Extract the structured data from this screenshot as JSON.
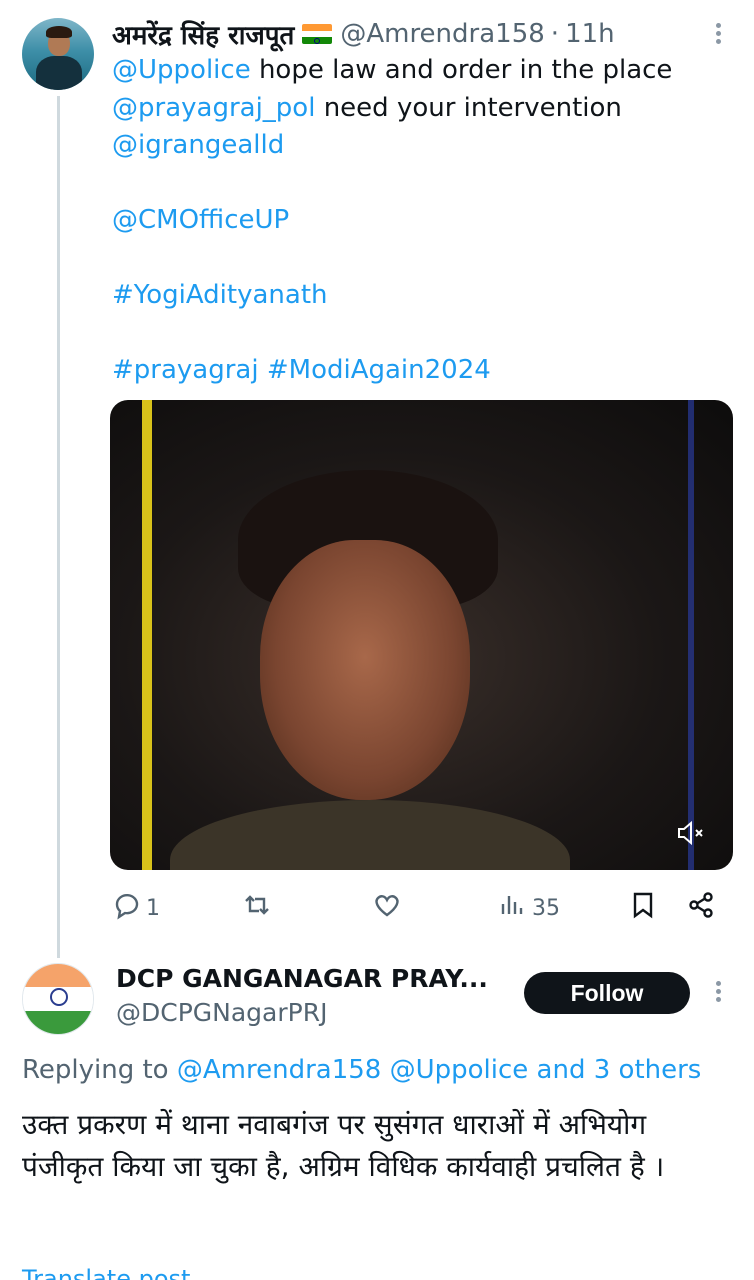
{
  "tweet1": {
    "display_name": "अमरेंद्र सिंह राजपूत",
    "handle": "@Amrendra158",
    "separator": "·",
    "time": "11h",
    "lines": [
      [
        {
          "text": "@Uppolice",
          "link": true
        },
        {
          "text": " hope law and order in the place",
          "link": false
        }
      ],
      [
        {
          "text": "@prayagraj_pol",
          "link": true
        },
        {
          "text": "  need your intervention",
          "link": false
        }
      ],
      [
        {
          "text": "@igrangealld",
          "link": true
        }
      ],
      [],
      [
        {
          "text": "@CMOfficeUP",
          "link": true
        }
      ],
      [],
      [
        {
          "text": "#YogiAdityanath",
          "link": true
        }
      ],
      [],
      [
        {
          "text": "#prayagraj",
          "link": true
        },
        {
          "text": " ",
          "link": false
        },
        {
          "text": "#ModiAgain2024",
          "link": true
        }
      ]
    ],
    "actions": {
      "reply_count": "1",
      "retweet_count": "",
      "like_count": "",
      "views_count": "35"
    }
  },
  "tweet2": {
    "display_name": "DCP GANGANAGAR PRAY...",
    "handle": "@DCPGNagarPRJ",
    "follow_label": "Follow",
    "replying_prefix": "Replying to",
    "replying_user1": "@Amrendra158",
    "replying_user2": "@Uppolice",
    "replying_and": "and",
    "replying_others": "3 others",
    "text": "उक्त प्रकरण में थाना नवाबगंज पर सुसंगत धाराओं में अभियोग पंजीकृत किया जा चुका है, अग्रिम विधिक कार्यवाही प्रचलित है ।",
    "translate_label": "Translate post"
  },
  "colors": {
    "link": "#1d9bf0",
    "secondary_text": "#536471",
    "primary_text": "#0f1419",
    "follow_bg": "#0f1419"
  },
  "icons": {
    "reply": "reply-icon",
    "retweet": "retweet-icon",
    "like": "heart-icon",
    "views": "views-icon",
    "bookmark": "bookmark-icon",
    "share": "share-icon",
    "mute": "volume-mute-icon",
    "more": "more-vertical-icon"
  }
}
